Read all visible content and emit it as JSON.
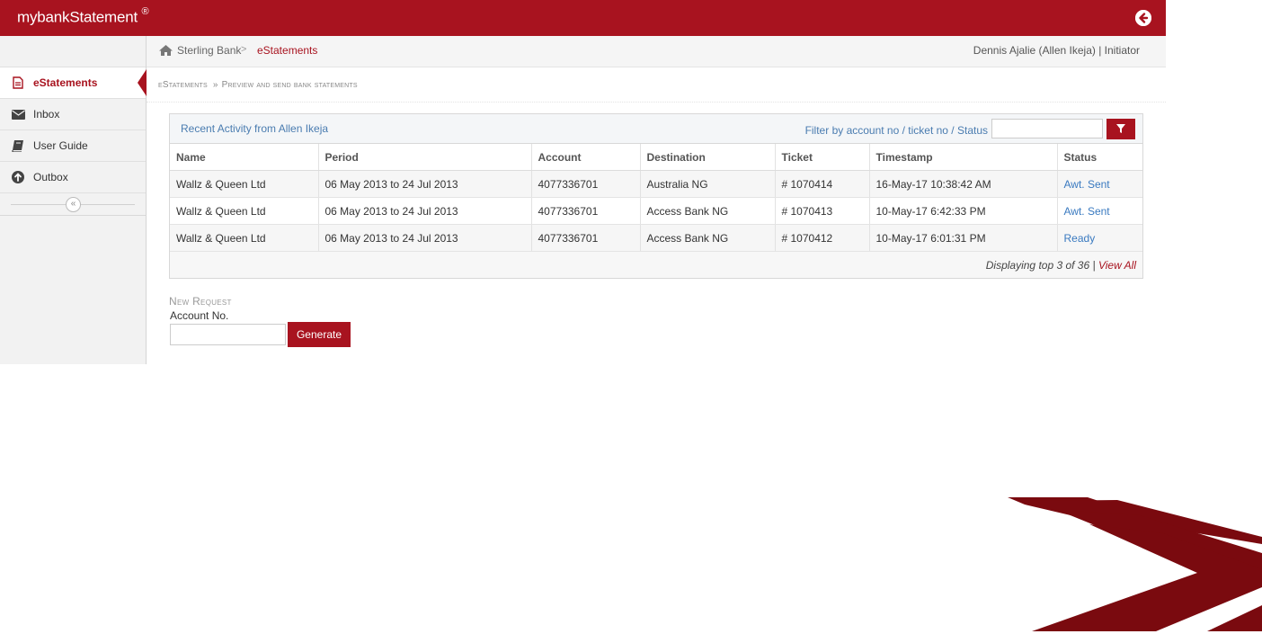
{
  "app": {
    "brand": "mybankStatement",
    "brand_mark": "®"
  },
  "sidebar": {
    "items": [
      {
        "label": "eStatements",
        "icon": "document-icon"
      },
      {
        "label": "Inbox",
        "icon": "envelope-icon"
      },
      {
        "label": "User Guide",
        "icon": "book-icon"
      },
      {
        "label": "Outbox",
        "icon": "arrow-up-circle-icon"
      }
    ],
    "collapse_glyph": "«"
  },
  "breadcrumb": {
    "home": "Sterling Bank",
    "separator": ">",
    "current": "eStatements"
  },
  "user": "Dennis Ajalie (Allen Ikeja) | Initiator",
  "page_header": {
    "section": "eStatements",
    "separator": "»",
    "subtitle": "Preview and send bank statements"
  },
  "activity": {
    "title": "Recent Activity from Allen Ikeja",
    "filter_label": "Filter by account no / ticket no / Status",
    "filter_value": "",
    "columns": [
      "Name",
      "Period",
      "Account",
      "Destination",
      "Ticket",
      "Timestamp",
      "Status"
    ],
    "rows": [
      {
        "name": "Wallz & Queen Ltd",
        "period": "06 May 2013 to 24 Jul 2013",
        "account": "4077336701",
        "destination": "Australia NG",
        "ticket": "# 1070414",
        "timestamp": "16-May-17 10:38:42 AM",
        "status": "Awt. Sent"
      },
      {
        "name": "Wallz & Queen Ltd",
        "period": "06 May 2013 to 24 Jul 2013",
        "account": "4077336701",
        "destination": "Access Bank NG",
        "ticket": "# 1070413",
        "timestamp": "10-May-17 6:42:33 PM",
        "status": "Awt. Sent"
      },
      {
        "name": "Wallz & Queen Ltd",
        "period": "06 May 2013 to 24 Jul 2013",
        "account": "4077336701",
        "destination": "Access Bank NG",
        "ticket": "# 1070412",
        "timestamp": "10-May-17 6:01:31 PM",
        "status": "Ready"
      }
    ],
    "footer_text": "Displaying top 3 of 36",
    "footer_sep": "|",
    "view_all": "View All"
  },
  "new_request": {
    "title": "New Request",
    "account_label": "Account No.",
    "account_value": "",
    "generate_label": "Generate"
  },
  "colors": {
    "brand": "#a8131f",
    "link": "#3a7ac0",
    "logo_dark": "#7a0a0f"
  }
}
